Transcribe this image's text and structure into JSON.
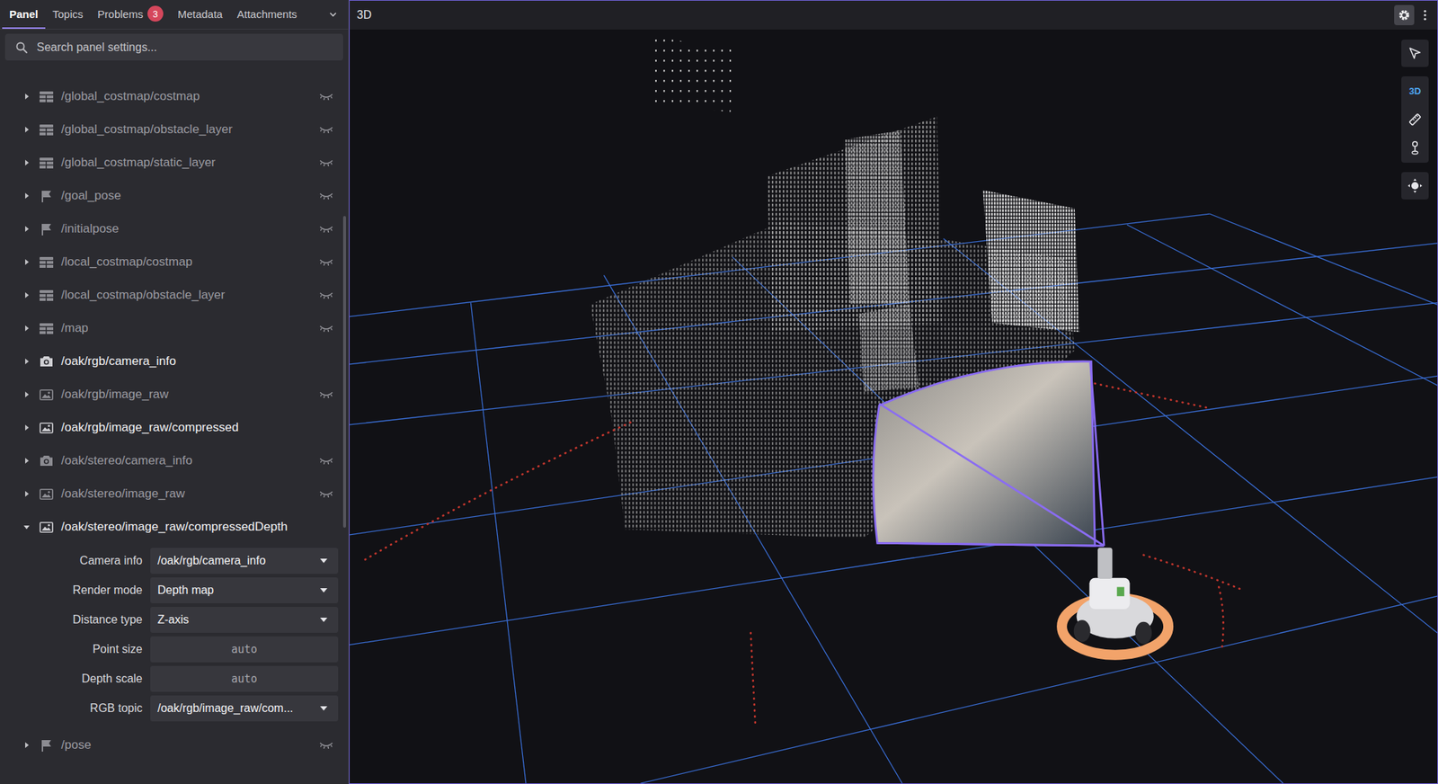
{
  "tabs": [
    {
      "label": "Panel",
      "selected": true
    },
    {
      "label": "Topics",
      "selected": false
    },
    {
      "label": "Problems",
      "selected": false,
      "badge": "3"
    },
    {
      "label": "Metadata",
      "selected": false
    },
    {
      "label": "Attachments",
      "selected": false
    }
  ],
  "search": {
    "placeholder": "Search panel settings..."
  },
  "topics": [
    {
      "name": "/global_costmap/costmap",
      "kind": "grid",
      "visible": false,
      "expanded": false
    },
    {
      "name": "/global_costmap/obstacle_layer",
      "kind": "grid",
      "visible": false,
      "expanded": false
    },
    {
      "name": "/global_costmap/static_layer",
      "kind": "grid",
      "visible": false,
      "expanded": false
    },
    {
      "name": "/goal_pose",
      "kind": "flag",
      "visible": false,
      "expanded": false
    },
    {
      "name": "/initialpose",
      "kind": "flag",
      "visible": false,
      "expanded": false
    },
    {
      "name": "/local_costmap/costmap",
      "kind": "grid",
      "visible": false,
      "expanded": false
    },
    {
      "name": "/local_costmap/obstacle_layer",
      "kind": "grid",
      "visible": false,
      "expanded": false
    },
    {
      "name": "/map",
      "kind": "grid",
      "visible": false,
      "expanded": false
    },
    {
      "name": "/oak/rgb/camera_info",
      "kind": "camera",
      "visible": true,
      "expanded": false
    },
    {
      "name": "/oak/rgb/image_raw",
      "kind": "image",
      "visible": false,
      "expanded": false
    },
    {
      "name": "/oak/rgb/image_raw/compressed",
      "kind": "image",
      "visible": true,
      "expanded": false
    },
    {
      "name": "/oak/stereo/camera_info",
      "kind": "camera",
      "visible": false,
      "expanded": false
    },
    {
      "name": "/oak/stereo/image_raw",
      "kind": "image",
      "visible": false,
      "expanded": false
    },
    {
      "name": "/oak/stereo/image_raw/compressedDepth",
      "kind": "image",
      "visible": true,
      "expanded": true,
      "settings": [
        {
          "label": "Camera info",
          "kind": "select",
          "value": "/oak/rgb/camera_info"
        },
        {
          "label": "Render mode",
          "kind": "select",
          "value": "Depth map"
        },
        {
          "label": "Distance type",
          "kind": "select",
          "value": "Z-axis"
        },
        {
          "label": "Point size",
          "kind": "input",
          "value": "auto"
        },
        {
          "label": "Depth scale",
          "kind": "input",
          "value": "auto"
        },
        {
          "label": "RGB topic",
          "kind": "select",
          "value": "/oak/rgb/image_raw/com..."
        }
      ]
    },
    {
      "name": "/pose",
      "kind": "flag",
      "visible": false,
      "expanded": false
    }
  ],
  "panel": {
    "title": "3D"
  },
  "toolbar": [
    {
      "kind": "select"
    },
    {
      "kind": "toggle",
      "label": "3D",
      "selected": true
    },
    {
      "kind": "measure"
    },
    {
      "kind": "publish"
    },
    {
      "kind": "follow"
    }
  ]
}
